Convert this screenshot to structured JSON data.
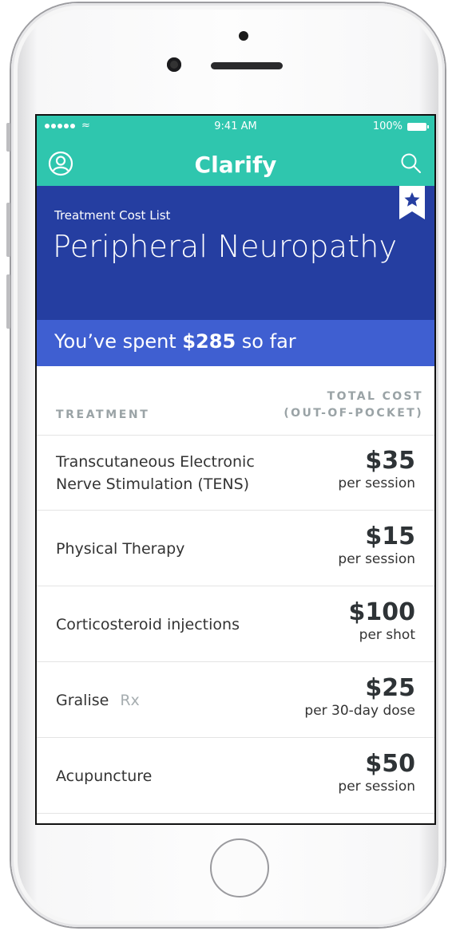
{
  "status_bar": {
    "time": "9:41 AM",
    "battery": "100%"
  },
  "nav": {
    "title": "Clarify"
  },
  "header": {
    "subtitle": "Treatment Cost List",
    "title": "Peripheral Neuropathy"
  },
  "spent": {
    "prefix": "You’ve spent",
    "amount": "$285",
    "suffix": "so far"
  },
  "table": {
    "col_treatment": "TREATMENT",
    "col_cost_line1": "TOTAL COST",
    "col_cost_line2": "(OUT-OF-POCKET)",
    "rows": [
      {
        "name": "Transcutaneous Electronic",
        "name2": "Nerve Stimulation (TENS)",
        "price": "$35",
        "unit": "per session"
      },
      {
        "name": "Physical Therapy",
        "price": "$15",
        "unit": "per session"
      },
      {
        "name": "Corticosteroid injections",
        "price": "$100",
        "unit": "per shot"
      },
      {
        "name": "Gralise",
        "tag": "Rx",
        "price": "$25",
        "unit": "per 30-day dose"
      },
      {
        "name": "Acupuncture",
        "price": "$50",
        "unit": "per session"
      }
    ]
  },
  "colors": {
    "nav_teal": "#2fc6ae",
    "header_navy": "#253ea1",
    "spent_blue": "#3f5fd1"
  },
  "icons": [
    "user-icon",
    "search-icon",
    "bookmark-star-icon",
    "wifi-icon",
    "battery-icon"
  ]
}
